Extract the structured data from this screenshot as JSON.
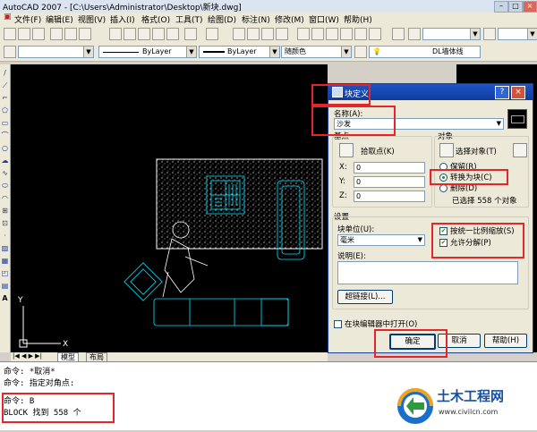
{
  "window": {
    "title": "AutoCAD 2007 - [C:\\Users\\Administrator\\Desktop\\新块.dwg]"
  },
  "menu": [
    "文件(F)",
    "编辑(E)",
    "视图(V)",
    "插入(I)",
    "格式(O)",
    "工具(T)",
    "绘图(D)",
    "标注(N)",
    "修改(M)",
    "窗口(W)",
    "帮助(H)"
  ],
  "properties_toolbar": {
    "linetype1": "ByLayer",
    "linetype2": "ByLayer",
    "color": "随颜色",
    "layer": "DL墙体线"
  },
  "tabs": {
    "model": "模型",
    "layout": "布局"
  },
  "ucs": {
    "x": "X",
    "y": "Y"
  },
  "dialog": {
    "title": "块定义",
    "name_label": "名称(A):",
    "name_value": "沙发",
    "basepoint": {
      "heading": "基点",
      "pick_label": "拾取点(K)",
      "x_label": "X:",
      "x_value": "0",
      "y_label": "Y:",
      "y_value": "0",
      "z_label": "Z:",
      "z_value": "0"
    },
    "objects": {
      "heading": "对象",
      "select_label": "选择对象(T)",
      "retain": "保留(R)",
      "convert": "转换为块(C)",
      "delete": "删除(D)",
      "selected_count": "已选择 558 个对象"
    },
    "settings": {
      "heading": "设置",
      "units_label": "块单位(U):",
      "units_value": "毫米",
      "desc_label": "说明(E):",
      "hyperlink": "超链接(L)...",
      "scale_uniform": "按统一比例缩放(S)",
      "allow_explode": "允许分解(P)"
    },
    "open_in_editor": "在块编辑器中打开(O)",
    "ok": "确定",
    "cancel": "取消",
    "help": "帮助(H)"
  },
  "command_lines": [
    "命令: *取消*",
    "命令: 指定对角点:",
    "命令: B",
    "BLOCK 找到 558 个"
  ],
  "logo": {
    "title": "土木工程网",
    "url": "www.civilcn.com"
  },
  "colors": {
    "highlight": "#e4262b",
    "cad_cyan": "#00e5ff",
    "dialog_title": "#1e55c8"
  }
}
